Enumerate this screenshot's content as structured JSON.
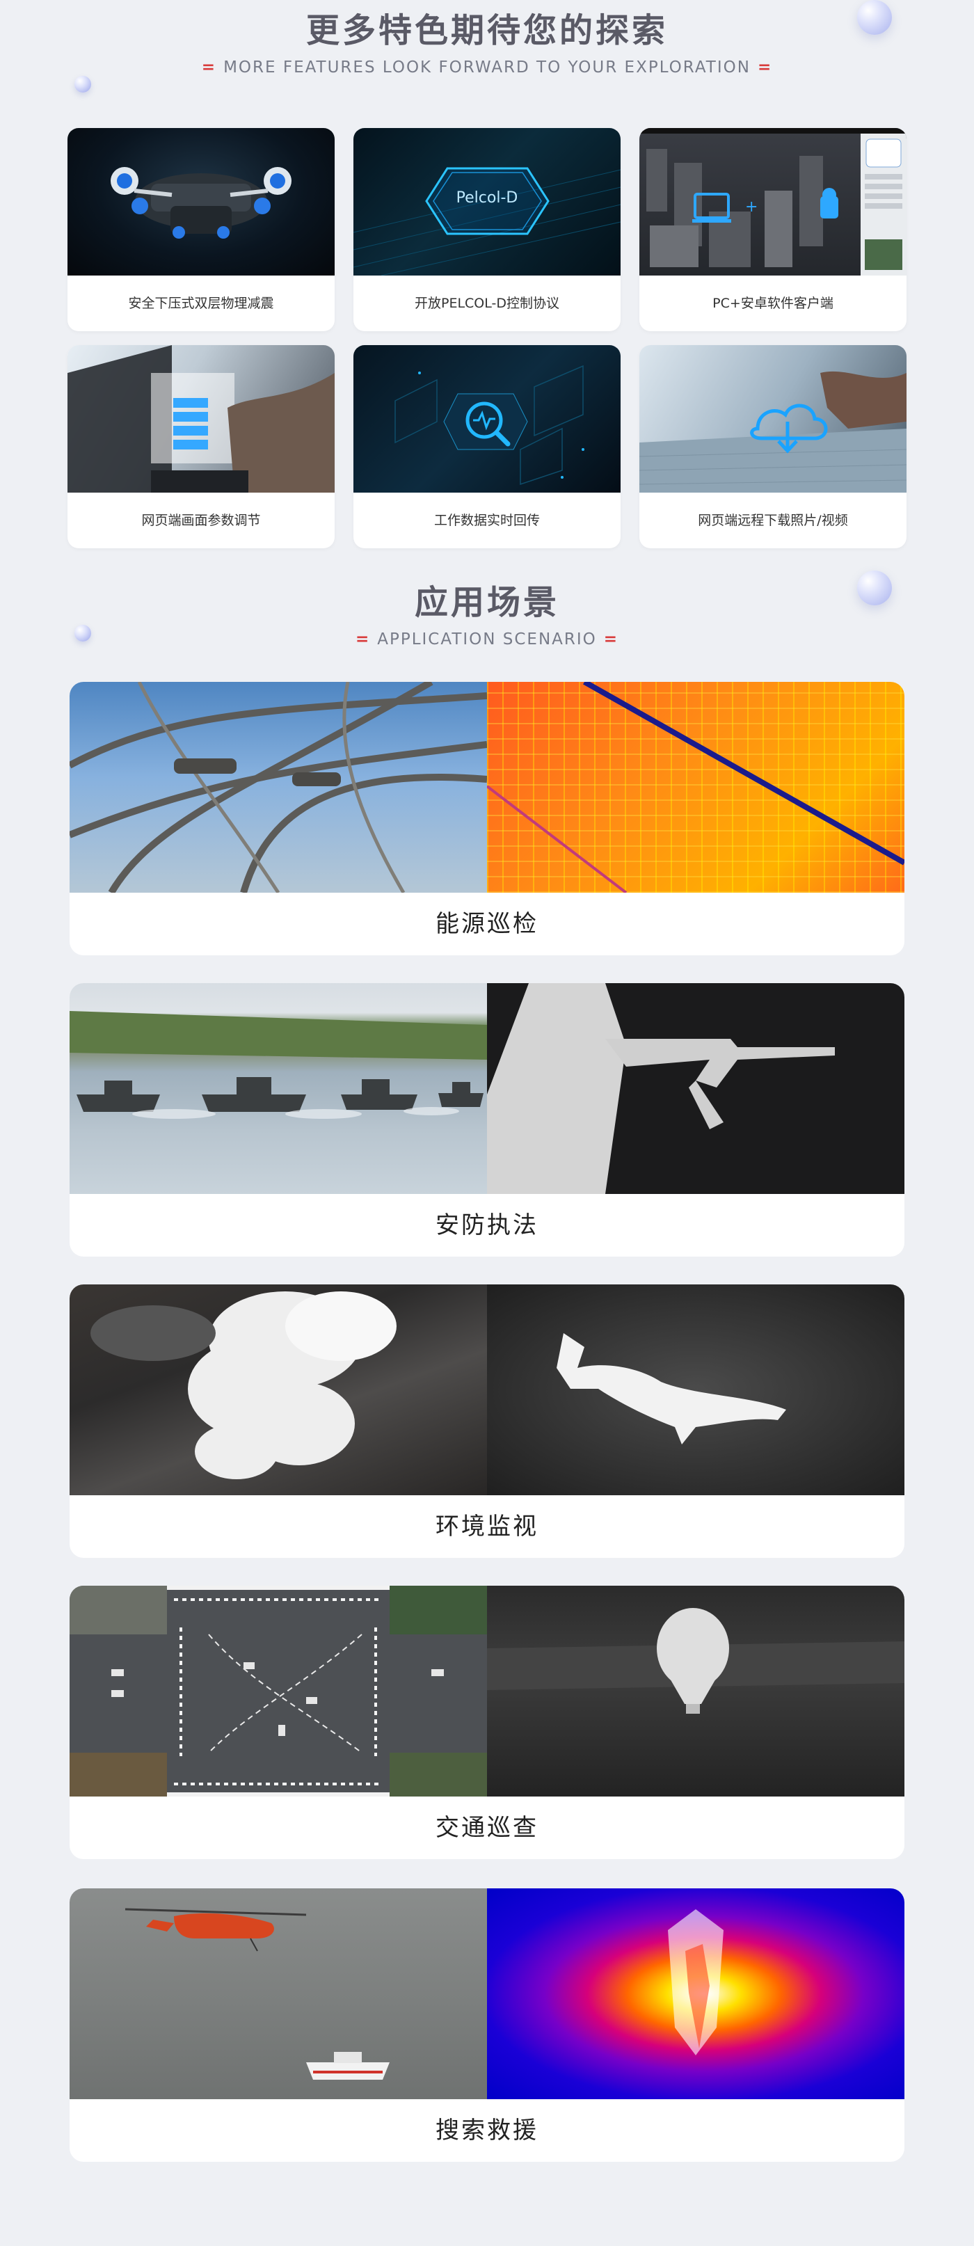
{
  "features_section": {
    "title": "更多特色期待您的探索",
    "subtitle": "MORE FEATURES LOOK FORWARD TO YOUR EXPLORATION",
    "sub_mark": "=",
    "cards": [
      {
        "caption": "安全下压式双层物理减震",
        "image": "gimbal-camera-image"
      },
      {
        "caption": "开放PELCOL-D控制协议",
        "image": "pelco-d-laptop-image",
        "overlay_text": "Pelcol-D"
      },
      {
        "caption": "PC+安卓软件客户端",
        "image": "pc-android-client-image"
      },
      {
        "caption": "网页端画面参数调节",
        "image": "web-parameter-adjust-image"
      },
      {
        "caption": "工作数据实时回传",
        "image": "realtime-data-return-image"
      },
      {
        "caption": "网页端远程下载照片/视频",
        "image": "remote-download-image"
      }
    ]
  },
  "scenes_section": {
    "title": "应用场景",
    "subtitle": "APPLICATION SCENARIO",
    "sub_mark": "=",
    "scenes": [
      {
        "caption": "能源巡检",
        "left_image": "power-line-insulator-photo",
        "right_image": "solar-panel-thermal-image"
      },
      {
        "caption": "安防执法",
        "left_image": "patrol-boats-photo",
        "right_image": "thermal-rifleman-image"
      },
      {
        "caption": "环境监视",
        "left_image": "smoke-plume-photo",
        "right_image": "thermal-whale-image"
      },
      {
        "caption": "交通巡查",
        "left_image": "intersection-aerial-photo",
        "right_image": "thermal-balloon-image"
      },
      {
        "caption": "搜索救援",
        "left_image": "helicopter-rescue-photo",
        "right_image": "thermal-rescue-image"
      }
    ]
  },
  "colors": {
    "background": "#eef0f4",
    "title": "#5a5a66",
    "subtitle": "#777b88",
    "accent_mark": "#d83a3a",
    "card": "#ffffff",
    "glow": "#22b8ff"
  }
}
